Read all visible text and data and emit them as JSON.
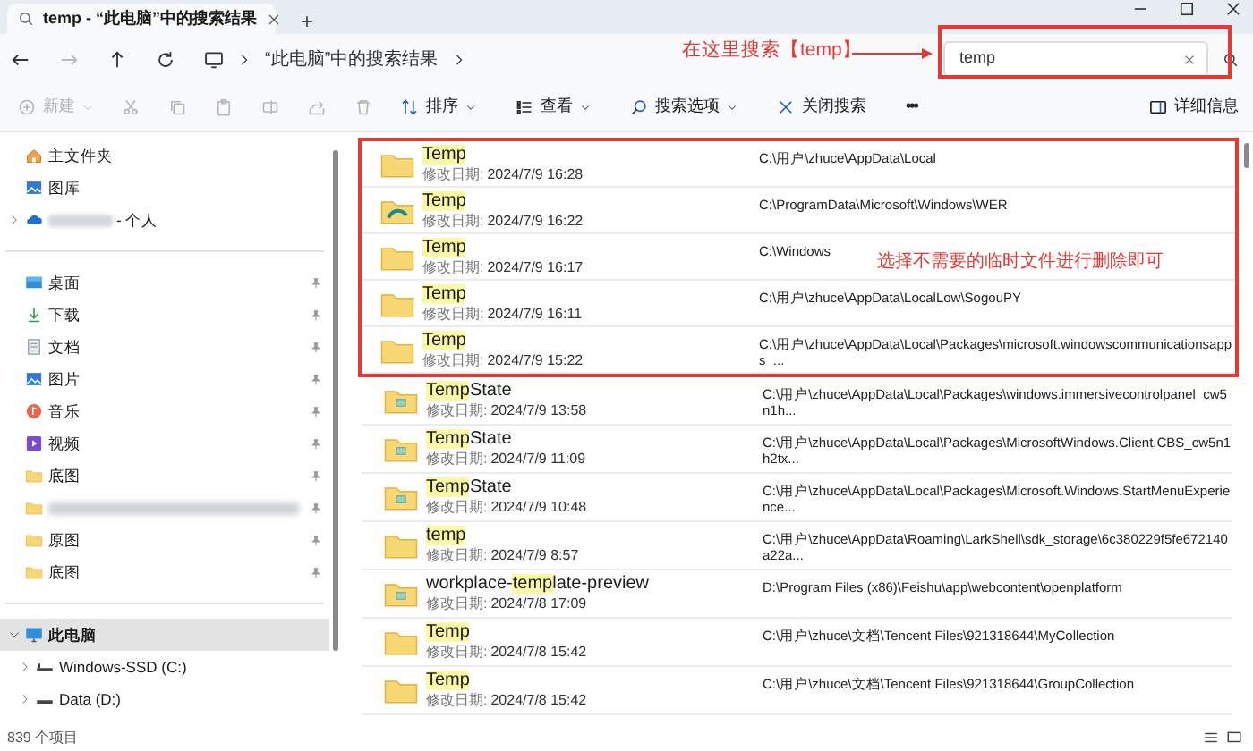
{
  "window": {
    "tab_title": "temp - “此电脑”中的搜索结果",
    "new_tab": "+"
  },
  "address_bar": {
    "breadcrumb": "“此电脑”中的搜索结果"
  },
  "search": {
    "value": "temp"
  },
  "toolbar": [
    {
      "kind": "new",
      "label": "新建",
      "disabled": true
    },
    {
      "kind": "cut",
      "disabled": true
    },
    {
      "kind": "copy",
      "disabled": true
    },
    {
      "kind": "paste",
      "disabled": true
    },
    {
      "kind": "rename",
      "disabled": true
    },
    {
      "kind": "share",
      "disabled": true
    },
    {
      "kind": "delete",
      "disabled": true
    },
    {
      "kind": "sort",
      "label": "排序",
      "disabled": false
    },
    {
      "kind": "view",
      "label": "查看",
      "disabled": false
    },
    {
      "kind": "search-options",
      "label": "搜索选项",
      "disabled": false
    },
    {
      "kind": "close-search",
      "label": "关闭搜索",
      "disabled": false
    },
    {
      "kind": "more",
      "label": "•••",
      "disabled": false
    }
  ],
  "details_button": "详细信息",
  "sidebar": {
    "items": [
      {
        "kind": "home",
        "label": "主文件夹",
        "pinned": false,
        "selected": false
      },
      {
        "kind": "gallery",
        "label": "图库",
        "pinned": false,
        "selected": false
      },
      {
        "kind": "cloud",
        "label": "- 个人",
        "pinned": false,
        "selected": false,
        "expanded": false
      },
      {
        "kind": "divider"
      },
      {
        "kind": "desktop",
        "label": "桌面",
        "pinned": true,
        "selected": false
      },
      {
        "kind": "download",
        "label": "下载",
        "pinned": true,
        "selected": false
      },
      {
        "kind": "documents",
        "label": "文档",
        "pinned": true,
        "selected": false
      },
      {
        "kind": "pictures",
        "label": "图片",
        "pinned": true,
        "selected": false
      },
      {
        "kind": "music",
        "label": "音乐",
        "pinned": true,
        "selected": false
      },
      {
        "kind": "videos",
        "label": "视频",
        "pinned": true,
        "selected": false
      },
      {
        "kind": "folder",
        "label": "底图",
        "pinned": true,
        "selected": false
      },
      {
        "kind": "blurred-folder",
        "pinned": true,
        "selected": false
      },
      {
        "kind": "folder",
        "label": "原图",
        "pinned": true,
        "selected": false
      },
      {
        "kind": "folder",
        "label": "底图",
        "pinned": true,
        "selected": false
      },
      {
        "kind": "divider"
      },
      {
        "kind": "pc",
        "label": "此电脑",
        "pinned": false,
        "selected": true,
        "expanded": true,
        "children": [
          {
            "kind": "ssd",
            "label": "Windows-SSD (C:)",
            "pinned": false,
            "selected": false,
            "expanded": false
          },
          {
            "kind": "drive",
            "label": "Data (D:)",
            "pinned": false,
            "selected": false,
            "expanded": false
          }
        ]
      }
    ]
  },
  "results": [
    {
      "kind": "folder",
      "name": [
        {
          "text": "Temp",
          "match": true
        }
      ],
      "modified_label": "修改日期:",
      "modified": "2024/7/9 16:28",
      "path": "C:\\用户\\zhuce\\AppData\\Local",
      "framed": true
    },
    {
      "kind": "folder-app",
      "name": [
        {
          "text": "Temp",
          "match": true
        }
      ],
      "modified_label": "修改日期:",
      "modified": "2024/7/9 16:22",
      "path": "C:\\ProgramData\\Microsoft\\Windows\\WER",
      "framed": true
    },
    {
      "kind": "folder",
      "name": [
        {
          "text": "Temp",
          "match": true
        }
      ],
      "modified_label": "修改日期:",
      "modified": "2024/7/9 16:17",
      "path": "C:\\Windows",
      "framed": true
    },
    {
      "kind": "folder",
      "name": [
        {
          "text": "Temp",
          "match": true
        }
      ],
      "modified_label": "修改日期:",
      "modified": "2024/7/9 16:11",
      "path": "C:\\用户\\zhuce\\AppData\\LocalLow\\SogouPY",
      "framed": true
    },
    {
      "kind": "folder",
      "name": [
        {
          "text": "Temp",
          "match": true
        }
      ],
      "modified_label": "修改日期:",
      "modified": "2024/7/9 15:22",
      "path": "C:\\用户\\zhuce\\AppData\\Local\\Packages\\microsoft.windowscommunicationsapps_...",
      "framed": true
    },
    {
      "kind": "folder-image",
      "name": [
        {
          "text": "Temp",
          "match": true
        },
        {
          "text": "State",
          "match": false
        }
      ],
      "modified_label": "修改日期:",
      "modified": "2024/7/9 13:58",
      "path": "C:\\用户\\zhuce\\AppData\\Local\\Packages\\windows.immersivecontrolpanel_cw5n1h...",
      "framed": false
    },
    {
      "kind": "folder-image",
      "name": [
        {
          "text": "Temp",
          "match": true
        },
        {
          "text": "State",
          "match": false
        }
      ],
      "modified_label": "修改日期:",
      "modified": "2024/7/9 11:09",
      "path": "C:\\用户\\zhuce\\AppData\\Local\\Packages\\MicrosoftWindows.Client.CBS_cw5n1h2tx...",
      "framed": false
    },
    {
      "kind": "folder-image",
      "name": [
        {
          "text": "Temp",
          "match": true
        },
        {
          "text": "State",
          "match": false
        }
      ],
      "modified_label": "修改日期:",
      "modified": "2024/7/9 10:48",
      "path": "C:\\用户\\zhuce\\AppData\\Local\\Packages\\Microsoft.Windows.StartMenuExperience...",
      "framed": false
    },
    {
      "kind": "folder",
      "name": [
        {
          "text": "temp",
          "match": true
        }
      ],
      "modified_label": "修改日期:",
      "modified": "2024/7/9 8:57",
      "path": "C:\\用户\\zhuce\\AppData\\Roaming\\LarkShell\\sdk_storage\\6c380229f5fe672140a22a...",
      "framed": false
    },
    {
      "kind": "folder-image",
      "name": [
        {
          "text": "workplace-",
          "match": false
        },
        {
          "text": "temp",
          "match": true
        },
        {
          "text": "late-preview",
          "match": false
        }
      ],
      "modified_label": "修改日期:",
      "modified": "2024/7/8 17:09",
      "path": "D:\\Program Files (x86)\\Feishu\\app\\webcontent\\openplatform",
      "framed": false
    },
    {
      "kind": "folder",
      "name": [
        {
          "text": "Temp",
          "match": true
        }
      ],
      "modified_label": "修改日期:",
      "modified": "2024/7/8 15:42",
      "path": "C:\\用户\\zhuce\\文档\\Tencent Files\\921318644\\MyCollection",
      "framed": false
    },
    {
      "kind": "folder",
      "name": [
        {
          "text": "Temp",
          "match": true
        }
      ],
      "modified_label": "修改日期:",
      "modified": "2024/7/8 15:42",
      "path": "C:\\用户\\zhuce\\文档\\Tencent Files\\921318644\\GroupCollection",
      "framed": false
    }
  ],
  "status_bar": {
    "count": "839 个项目"
  },
  "annotations": [
    {
      "kind": "search-callout",
      "text": "在这里搜索【temp】"
    },
    {
      "kind": "rows-callout",
      "text": "选择不需要的临时文件进行删除即可"
    }
  ]
}
